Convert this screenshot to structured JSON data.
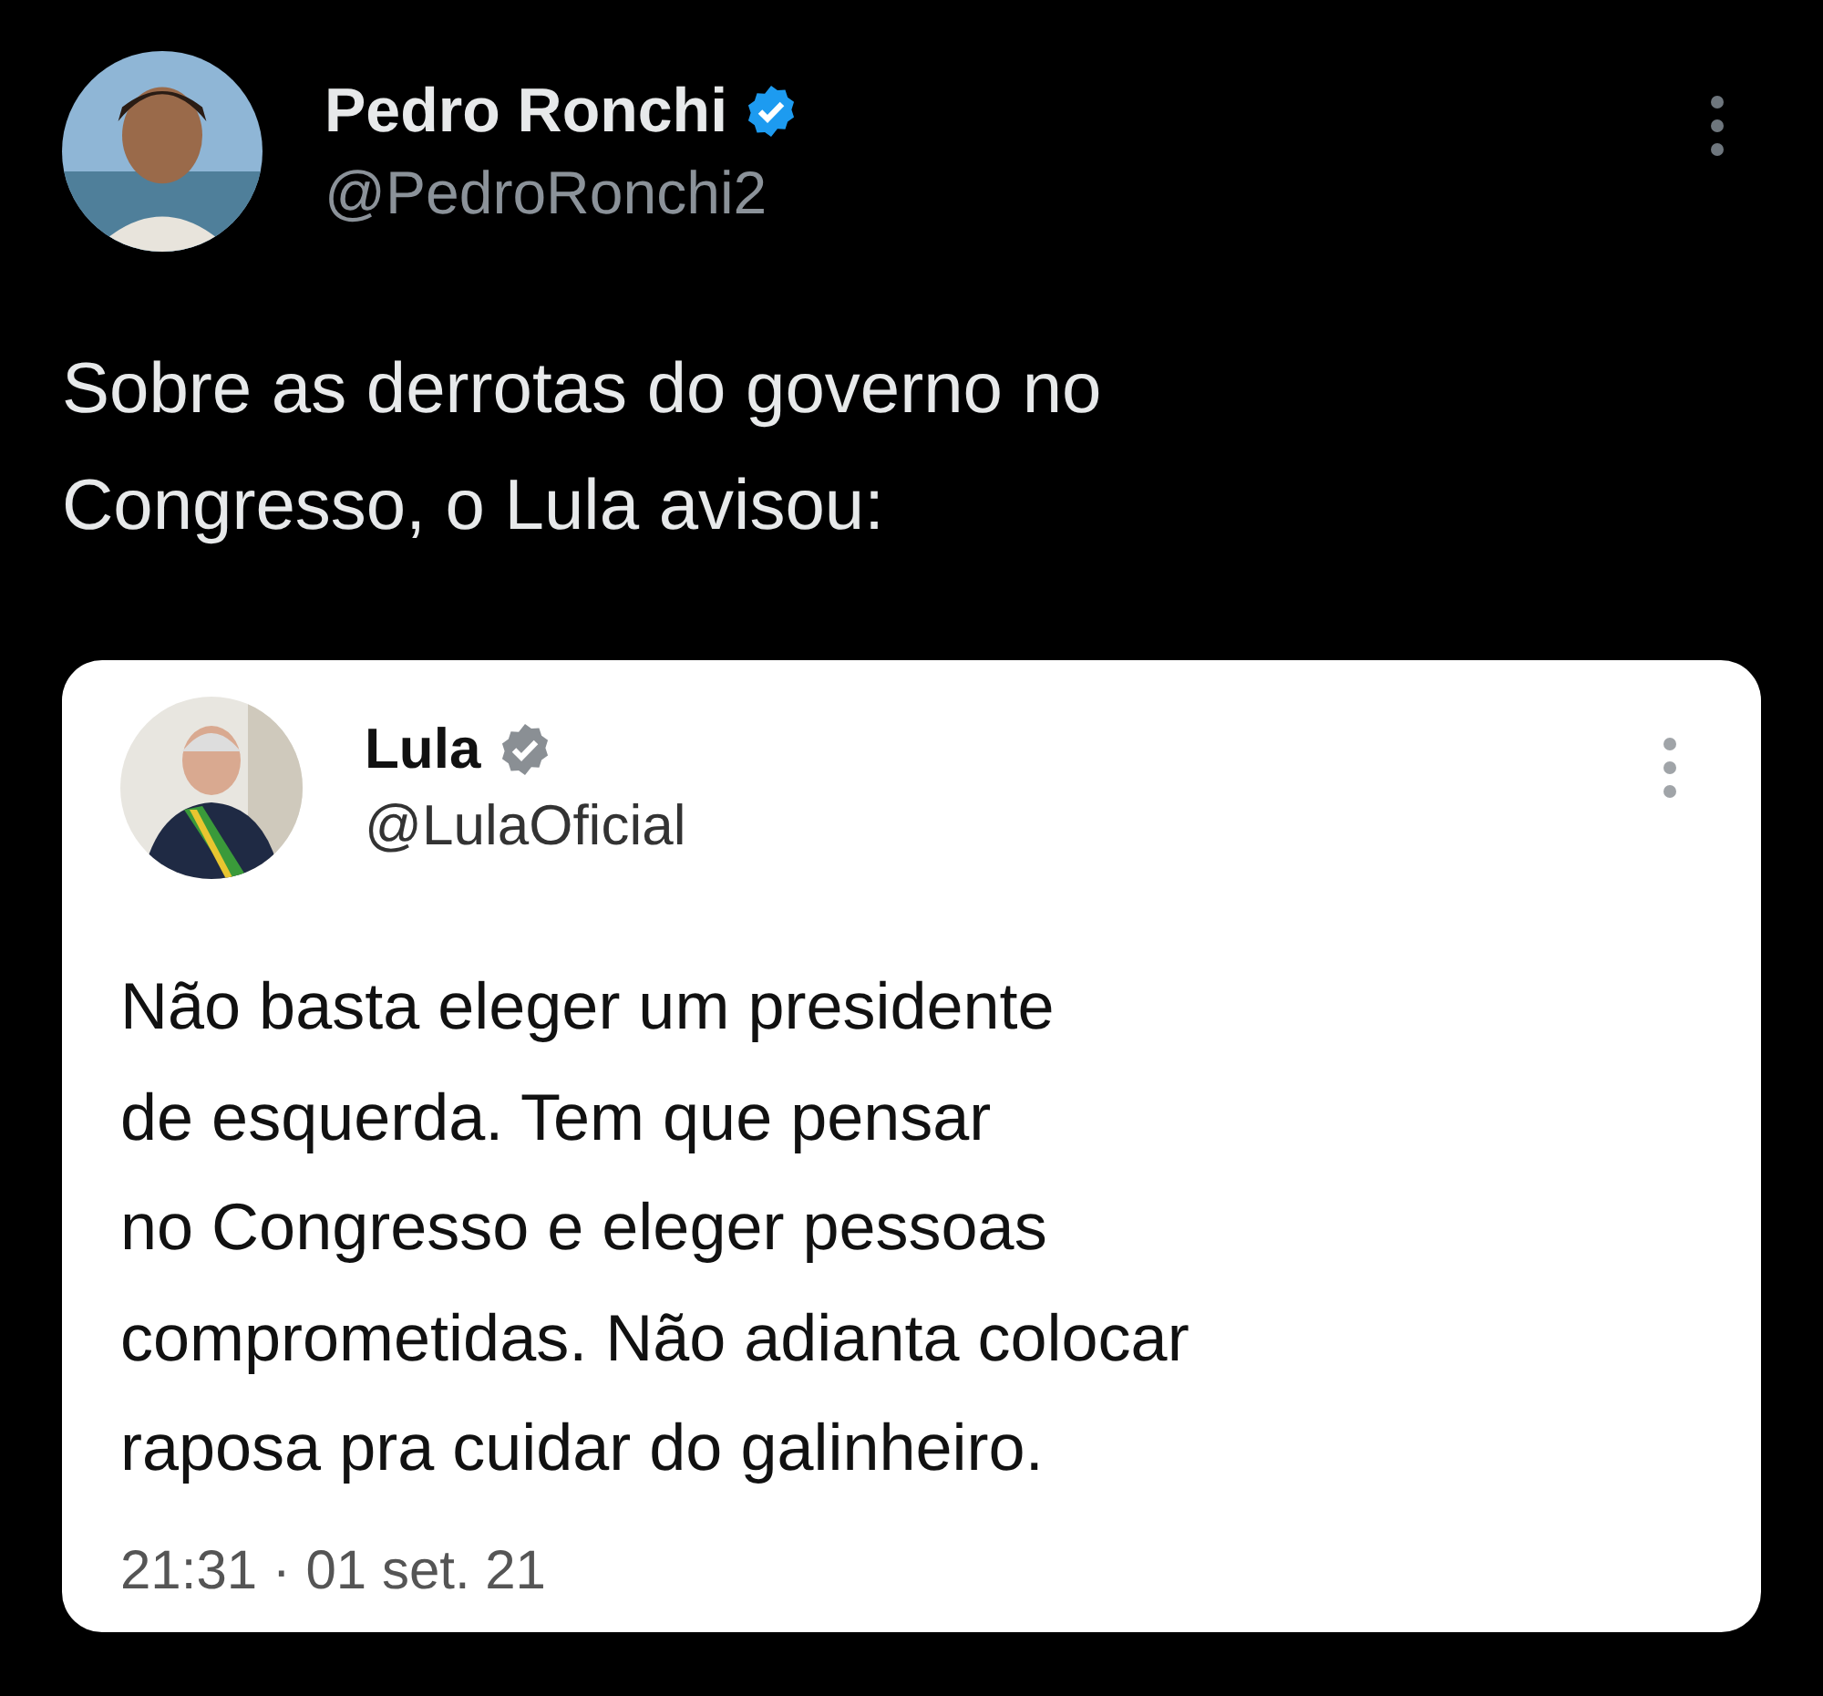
{
  "tweet": {
    "author": {
      "name": "Pedro Ronchi",
      "handle": "@PedroRonchi2",
      "verified": true
    },
    "text": [
      "Sobre as derrotas do governo no",
      "Congresso, o Lula avisou:"
    ],
    "quoted": {
      "author": {
        "name": "Lula",
        "handle": "@LulaOficial",
        "verified": true
      },
      "lines": [
        "Não basta eleger um presidente",
        "de esquerda. Tem que pensar",
        "no Congresso e eleger pessoas",
        "comprometidas. Não adianta colocar",
        "raposa pra cuidar do galinheiro."
      ],
      "timestamp": "21:31 · 01 set. 21"
    }
  }
}
